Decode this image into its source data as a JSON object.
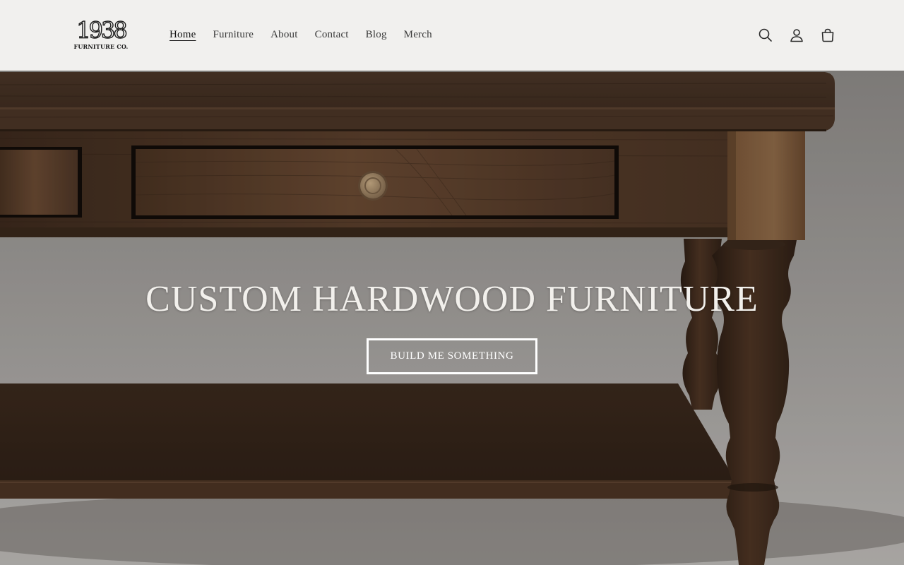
{
  "brand": {
    "logo_number": "1938",
    "logo_sub": "FURNITURE CO."
  },
  "nav": {
    "items": [
      {
        "label": "Home",
        "active": true
      },
      {
        "label": "Furniture",
        "active": false
      },
      {
        "label": "About",
        "active": false
      },
      {
        "label": "Contact",
        "active": false
      },
      {
        "label": "Blog",
        "active": false
      },
      {
        "label": "Merch",
        "active": false
      }
    ]
  },
  "header_icons": [
    "search-icon",
    "account-icon",
    "cart-icon"
  ],
  "hero": {
    "title": "CUSTOM HARDWOOD FURNITURE",
    "button_label": "BUILD ME SOMETHING",
    "image_subject": "dark walnut wood coffee table with drawers, turned legs and lower shelf"
  },
  "colors": {
    "header_bg": "#f1f0ee",
    "text": "#121212",
    "wood_dark": "#3e2a1d",
    "wood_light": "#6b4a33",
    "hero_text": "#f2f0ec"
  }
}
